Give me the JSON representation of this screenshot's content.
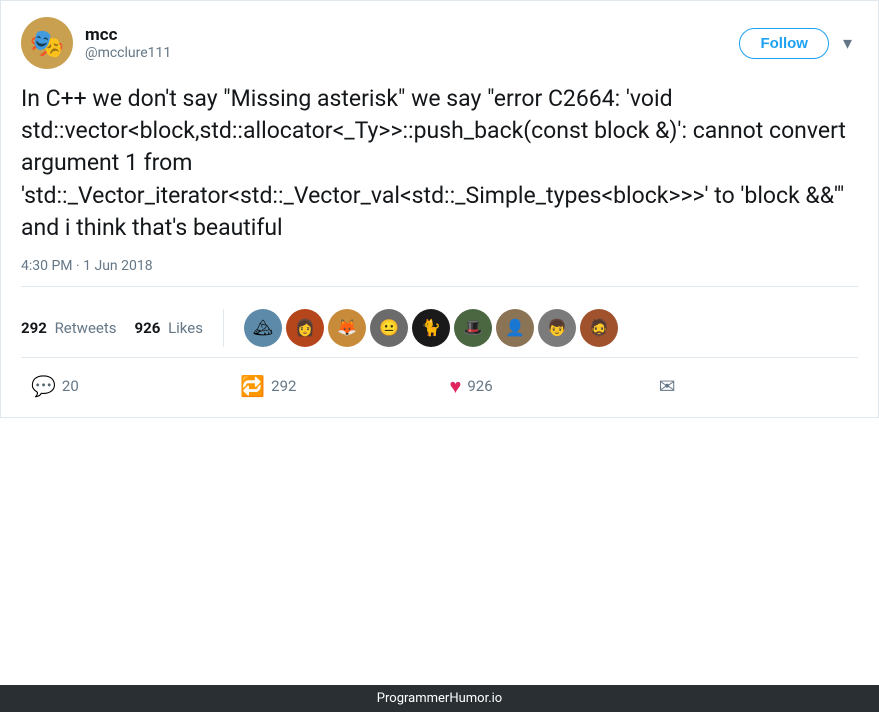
{
  "header": {
    "user_name": "mcc",
    "user_handle": "@mcclure111",
    "follow_label": "Follow",
    "chevron": "▾"
  },
  "tweet": {
    "body": "In C++ we don't say \"Missing asterisk\" we say \"error C2664: 'void std::vector<block,std::allocator<_Ty>>::push_back(const block &)': cannot convert argument 1 from 'std::_Vector_iterator<std::_Vector_val<std::_Simple_types<block>>>' to 'block &&'\" and i think that's beautiful",
    "timestamp": "4:30 PM · 1 Jun 2018"
  },
  "stats": {
    "retweets_count": "292",
    "retweets_label": "Retweets",
    "likes_count": "926",
    "likes_label": "Likes"
  },
  "actions": {
    "reply_count": "20",
    "retweet_count": "292",
    "like_count": "926"
  },
  "footer": {
    "text": "ProgrammerHumor.io"
  },
  "avatar": {
    "emoji": "🎭"
  }
}
